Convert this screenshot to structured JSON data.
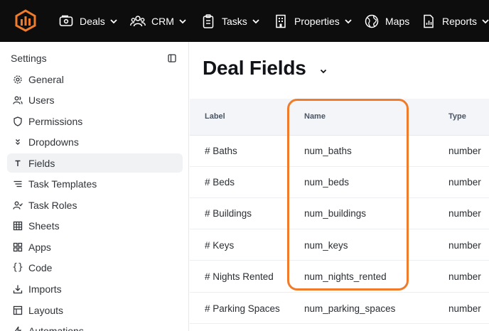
{
  "topnav": {
    "items": [
      {
        "label": "Deals",
        "icon": "wallet-icon",
        "has_dropdown": true
      },
      {
        "label": "CRM",
        "icon": "users-icon",
        "has_dropdown": true
      },
      {
        "label": "Tasks",
        "icon": "clipboard-icon",
        "has_dropdown": true
      },
      {
        "label": "Properties",
        "icon": "building-icon",
        "has_dropdown": true
      },
      {
        "label": "Maps",
        "icon": "globe-icon",
        "has_dropdown": false
      },
      {
        "label": "Reports",
        "icon": "report-icon",
        "has_dropdown": true
      }
    ]
  },
  "sidebar": {
    "title": "Settings",
    "items": [
      {
        "label": "General",
        "icon": "gear-icon"
      },
      {
        "label": "Users",
        "icon": "users-icon"
      },
      {
        "label": "Permissions",
        "icon": "shield-icon"
      },
      {
        "label": "Dropdowns",
        "icon": "chevrons-down-icon"
      },
      {
        "label": "Fields",
        "icon": "text-icon",
        "active": true
      },
      {
        "label": "Task Templates",
        "icon": "list-icon"
      },
      {
        "label": "Task Roles",
        "icon": "user-check-icon"
      },
      {
        "label": "Sheets",
        "icon": "grid-icon"
      },
      {
        "label": "Apps",
        "icon": "apps-icon"
      },
      {
        "label": "Code",
        "icon": "braces-icon"
      },
      {
        "label": "Imports",
        "icon": "download-icon"
      },
      {
        "label": "Layouts",
        "icon": "layout-icon"
      },
      {
        "label": "Automations",
        "icon": "bolt-icon"
      }
    ]
  },
  "main": {
    "title": "Deal Fields",
    "table": {
      "columns": [
        "Label",
        "Name",
        "Type"
      ],
      "rows": [
        {
          "label": "# Baths",
          "name": "num_baths",
          "type": "number"
        },
        {
          "label": "# Beds",
          "name": "num_beds",
          "type": "number"
        },
        {
          "label": "# Buildings",
          "name": "num_buildings",
          "type": "number"
        },
        {
          "label": "# Keys",
          "name": "num_keys",
          "type": "number"
        },
        {
          "label": "# Nights Rented",
          "name": "num_nights_rented",
          "type": "number"
        },
        {
          "label": "# Parking Spaces",
          "name": "num_parking_spaces",
          "type": "number"
        }
      ]
    }
  },
  "colors": {
    "topbar": "#0d0d0d",
    "brand": "#f07c2b",
    "highlight": "#f07c2b",
    "active_item": "#f1f2f4"
  }
}
